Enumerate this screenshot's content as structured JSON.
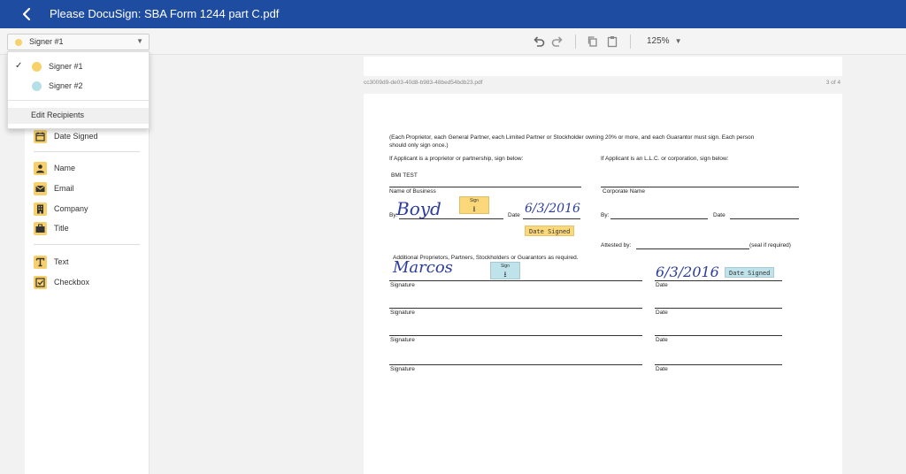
{
  "header": {
    "title": "Please DocuSign: SBA Form 1244 part C.pdf"
  },
  "toolbar": {
    "zoom": "125%"
  },
  "signer_select": {
    "label": "Signer #1"
  },
  "dropdown": {
    "items": [
      {
        "label": "Signer #1",
        "color": "#f7d26a",
        "checked": true
      },
      {
        "label": "Signer #2",
        "color": "#b6e0e8",
        "checked": false
      }
    ],
    "edit_label": "Edit Recipients"
  },
  "sidebar": {
    "tools": [
      {
        "label": "Date Signed",
        "icon": "calendar-icon"
      },
      {
        "label": "Name",
        "icon": "person-icon"
      },
      {
        "label": "Email",
        "icon": "envelope-icon"
      },
      {
        "label": "Company",
        "icon": "building-icon"
      },
      {
        "label": "Title",
        "icon": "briefcase-icon"
      },
      {
        "label": "Text",
        "icon": "text-icon"
      },
      {
        "label": "Checkbox",
        "icon": "checkbox-icon"
      }
    ]
  },
  "document": {
    "filename": "cc3009d9-de03-40d8-b983-48bed54bdb23.pdf",
    "page_num": "3 of 4",
    "intro": "(Each Proprietor, each General Partner, each Limited Partner or Stockholder owning 20% or more, and each Guarantor must sign. Each person",
    "intro2": "should only sign once.)",
    "left_heading": "If Applicant is a proprietor or partnership, sign below:",
    "right_heading": "If Applicant is an L.L.C. or corporation, sign below:",
    "business_name": "BMI TEST",
    "name_of_business": "Name of Business",
    "corporate_name": "Corporate Name",
    "by": "By:",
    "date": "Date",
    "attested_by": "Attested by:",
    "seal": "(seal if required)",
    "additional": "Additional Proprietors, Partners, Stockholders or Guarantors as required.",
    "signature": "Signature",
    "sign_tag": "Sign",
    "date_signed_tag": "Date Signed",
    "sig1_hand": "Boyd",
    "date1_hand": "6/3/2016",
    "sig2_hand": "Marcos",
    "date2_hand": "6/3/2016",
    "colors": {
      "signer1": "#fbd97a",
      "signer2": "#bfe3ea"
    }
  }
}
